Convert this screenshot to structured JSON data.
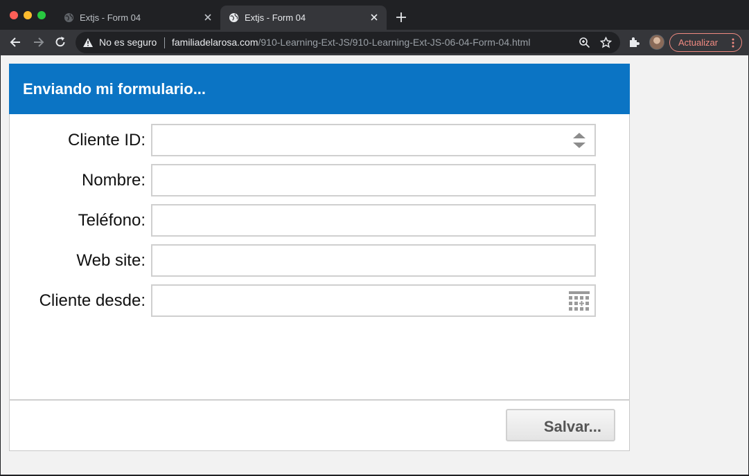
{
  "browser": {
    "tabs": [
      {
        "title": "Extjs - Form 04",
        "active": false
      },
      {
        "title": "Extjs - Form 04",
        "active": true
      }
    ],
    "address_bar": {
      "security_text": "No es seguro",
      "host": "familiadelarosa.com",
      "path": "/910-Learning-Ext-JS/910-Learning-Ext-JS-06-04-Form-04.html"
    },
    "update_button_label": "Actualizar"
  },
  "panel": {
    "title": "Enviando mi formulario...",
    "header_color": "#0b74c4"
  },
  "form": {
    "fields": [
      {
        "label": "Cliente ID:",
        "value": "",
        "type": "number",
        "trigger_icon": "spinner-icon"
      },
      {
        "label": "Nombre:",
        "value": "",
        "type": "text"
      },
      {
        "label": "Teléfono:",
        "value": "",
        "type": "text"
      },
      {
        "label": "Web site:",
        "value": "",
        "type": "text"
      },
      {
        "label": "Cliente desde:",
        "value": "",
        "type": "date",
        "trigger_icon": "calendar-icon"
      }
    ],
    "submit_label": "Salvar..."
  }
}
